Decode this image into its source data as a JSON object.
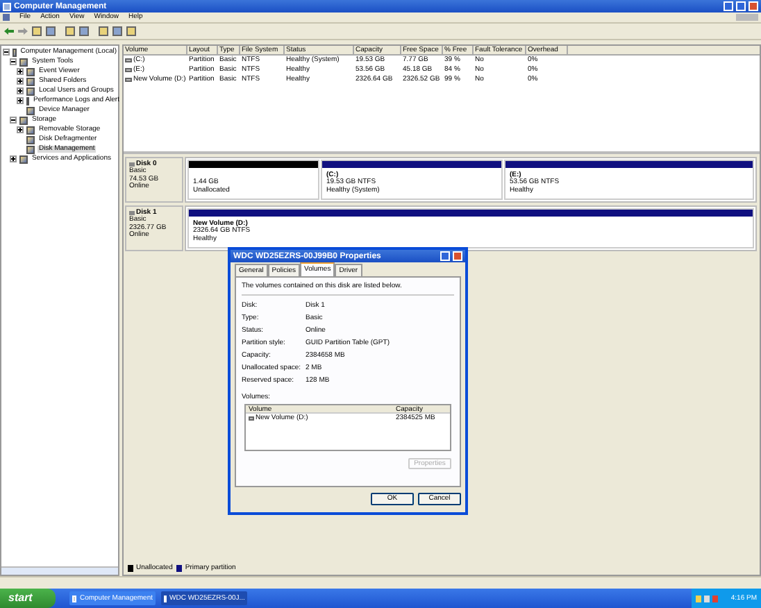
{
  "window": {
    "title": "Computer Management"
  },
  "menu": [
    "File",
    "Action",
    "View",
    "Window",
    "Help"
  ],
  "tree": [
    {
      "label": "Computer Management (Local)",
      "expanded": true,
      "selected": false,
      "children": [
        {
          "label": "System Tools",
          "expanded": true,
          "selected": false,
          "children": [
            {
              "label": "Event Viewer",
              "expanded": false,
              "selected": false
            },
            {
              "label": "Shared Folders",
              "expanded": false,
              "selected": false
            },
            {
              "label": "Local Users and Groups",
              "expanded": false,
              "selected": false
            },
            {
              "label": "Performance Logs and Alert",
              "expanded": false,
              "selected": false
            },
            {
              "label": "Device Manager",
              "selected": false
            }
          ]
        },
        {
          "label": "Storage",
          "expanded": true,
          "selected": false,
          "children": [
            {
              "label": "Removable Storage",
              "expanded": false,
              "selected": false
            },
            {
              "label": "Disk Defragmenter",
              "selected": false
            },
            {
              "label": "Disk Management",
              "selected": true
            }
          ]
        },
        {
          "label": "Services and Applications",
          "expanded": false,
          "selected": false
        }
      ]
    }
  ],
  "volumes": {
    "columns": [
      "Volume",
      "Layout",
      "Type",
      "File System",
      "Status",
      "Capacity",
      "Free Space",
      "% Free",
      "Fault Tolerance",
      "Overhead"
    ],
    "rows": [
      [
        "(C:)",
        "Partition",
        "Basic",
        "NTFS",
        "Healthy (System)",
        "19.53 GB",
        "7.77 GB",
        "39 %",
        "No",
        "0%"
      ],
      [
        "(E:)",
        "Partition",
        "Basic",
        "NTFS",
        "Healthy",
        "53.56 GB",
        "45.18 GB",
        "84 %",
        "No",
        "0%"
      ],
      [
        "New Volume (D:)",
        "Partition",
        "Basic",
        "NTFS",
        "Healthy",
        "2326.64 GB",
        "2326.52 GB",
        "99 %",
        "No",
        "0%"
      ]
    ]
  },
  "disks": [
    {
      "name": "Disk 0",
      "type": "Basic",
      "size": "74.53 GB",
      "status": "Online",
      "partitions": [
        {
          "kind": "unallocated",
          "lines": [
            "1.44 GB",
            "Unallocated"
          ]
        },
        {
          "kind": "primary",
          "title": "(C:)",
          "lines": [
            "19.53 GB NTFS",
            "Healthy (System)"
          ]
        },
        {
          "kind": "primary",
          "title": "(E:)",
          "lines": [
            "53.56 GB NTFS",
            "Healthy"
          ]
        }
      ]
    },
    {
      "name": "Disk 1",
      "type": "Basic",
      "size": "2326.77 GB",
      "status": "Online",
      "partitions": [
        {
          "kind": "primary",
          "title": "New Volume  (D:)",
          "lines": [
            "2326.64 GB NTFS",
            "Healthy"
          ]
        }
      ]
    }
  ],
  "legend": [
    {
      "kind": "unallocated",
      "label": "Unallocated"
    },
    {
      "kind": "primary",
      "label": "Primary partition"
    }
  ],
  "dialog": {
    "title": "WDC WD25EZRS-00J99B0 Properties",
    "tabs": [
      {
        "label": "General",
        "selected": false
      },
      {
        "label": "Policies",
        "selected": false
      },
      {
        "label": "Volumes",
        "selected": true
      },
      {
        "label": "Driver",
        "selected": false
      }
    ],
    "description": "The volumes contained on this disk are listed below.",
    "fields": [
      {
        "label": "Disk:",
        "value": "Disk 1"
      },
      {
        "label": "Type:",
        "value": "Basic"
      },
      {
        "label": "Status:",
        "value": "Online"
      },
      {
        "label": "Partition style:",
        "value": "GUID Partition Table (GPT)"
      },
      {
        "label": "Capacity:",
        "value": "2384658 MB"
      },
      {
        "label": "Unallocated space:",
        "value": "2 MB"
      },
      {
        "label": "Reserved space:",
        "value": "128 MB"
      }
    ],
    "volumes_label": "Volumes:",
    "columns": [
      "Volume",
      "Capacity"
    ],
    "rows": [
      [
        "New Volume (D:)",
        "2384525 MB"
      ]
    ],
    "properties_button": {
      "label": "Properties",
      "disabled": true
    },
    "buttons": [
      "OK",
      "Cancel"
    ]
  },
  "taskbar": {
    "start": "start",
    "tasks": [
      {
        "label": "Computer Management",
        "selected": false
      },
      {
        "label": "WDC WD25EZRS-00J...",
        "selected": true
      }
    ],
    "clock": "4:16 PM"
  }
}
